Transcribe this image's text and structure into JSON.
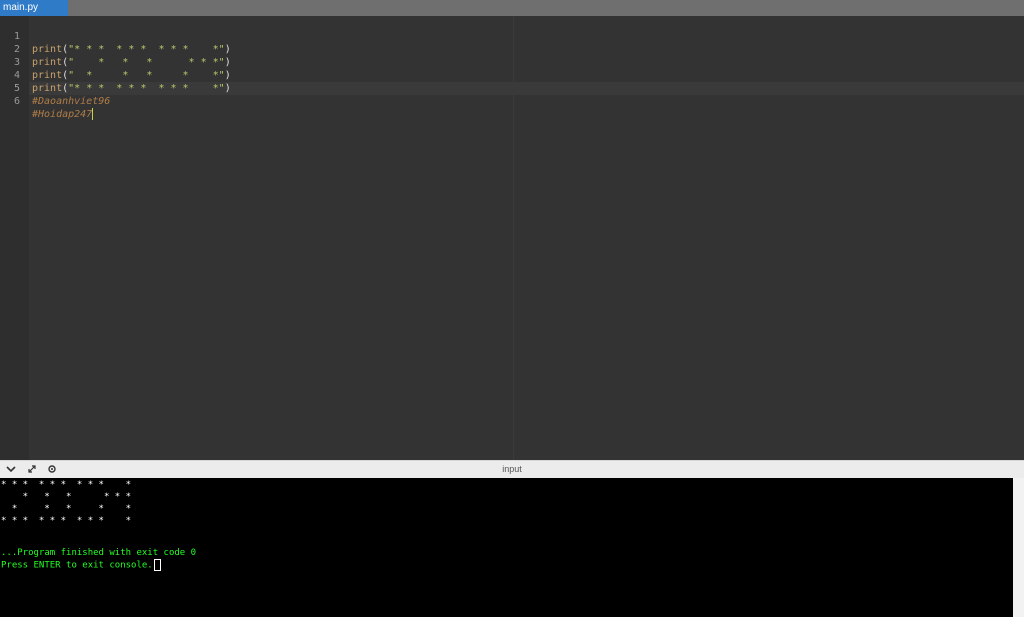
{
  "tab": {
    "filename": "main.py"
  },
  "editor": {
    "lines": [
      {
        "num": "1",
        "fn": "print",
        "open": "(",
        "str": "\"* * *  * * *  * * *    *\"",
        "close": ")"
      },
      {
        "num": "2",
        "fn": "print",
        "open": "(",
        "str": "\"    *   *   *      * * *\"",
        "close": ")"
      },
      {
        "num": "3",
        "fn": "print",
        "open": "(",
        "str": "\"  *     *   *     *    *\"",
        "close": ")"
      },
      {
        "num": "4",
        "fn": "print",
        "open": "(",
        "str": "\"* * *  * * *  * * *    *\"",
        "close": ")"
      },
      {
        "num": "5",
        "comment": "#Daoanhviet96"
      },
      {
        "num": "6",
        "comment": "#Hoidap247"
      }
    ]
  },
  "console": {
    "title": "input",
    "icons": [
      "chevron-down-icon",
      "expand-icon",
      "settings-icon"
    ],
    "output_lines": [
      "* * *  * * *  * * *    *",
      "    *   *   *      * * *",
      "  *     *   *     *    *",
      "* * *  * * *  * * *    *"
    ],
    "finished": "...Program finished with exit code 0",
    "prompt": "Press ENTER to exit console."
  }
}
